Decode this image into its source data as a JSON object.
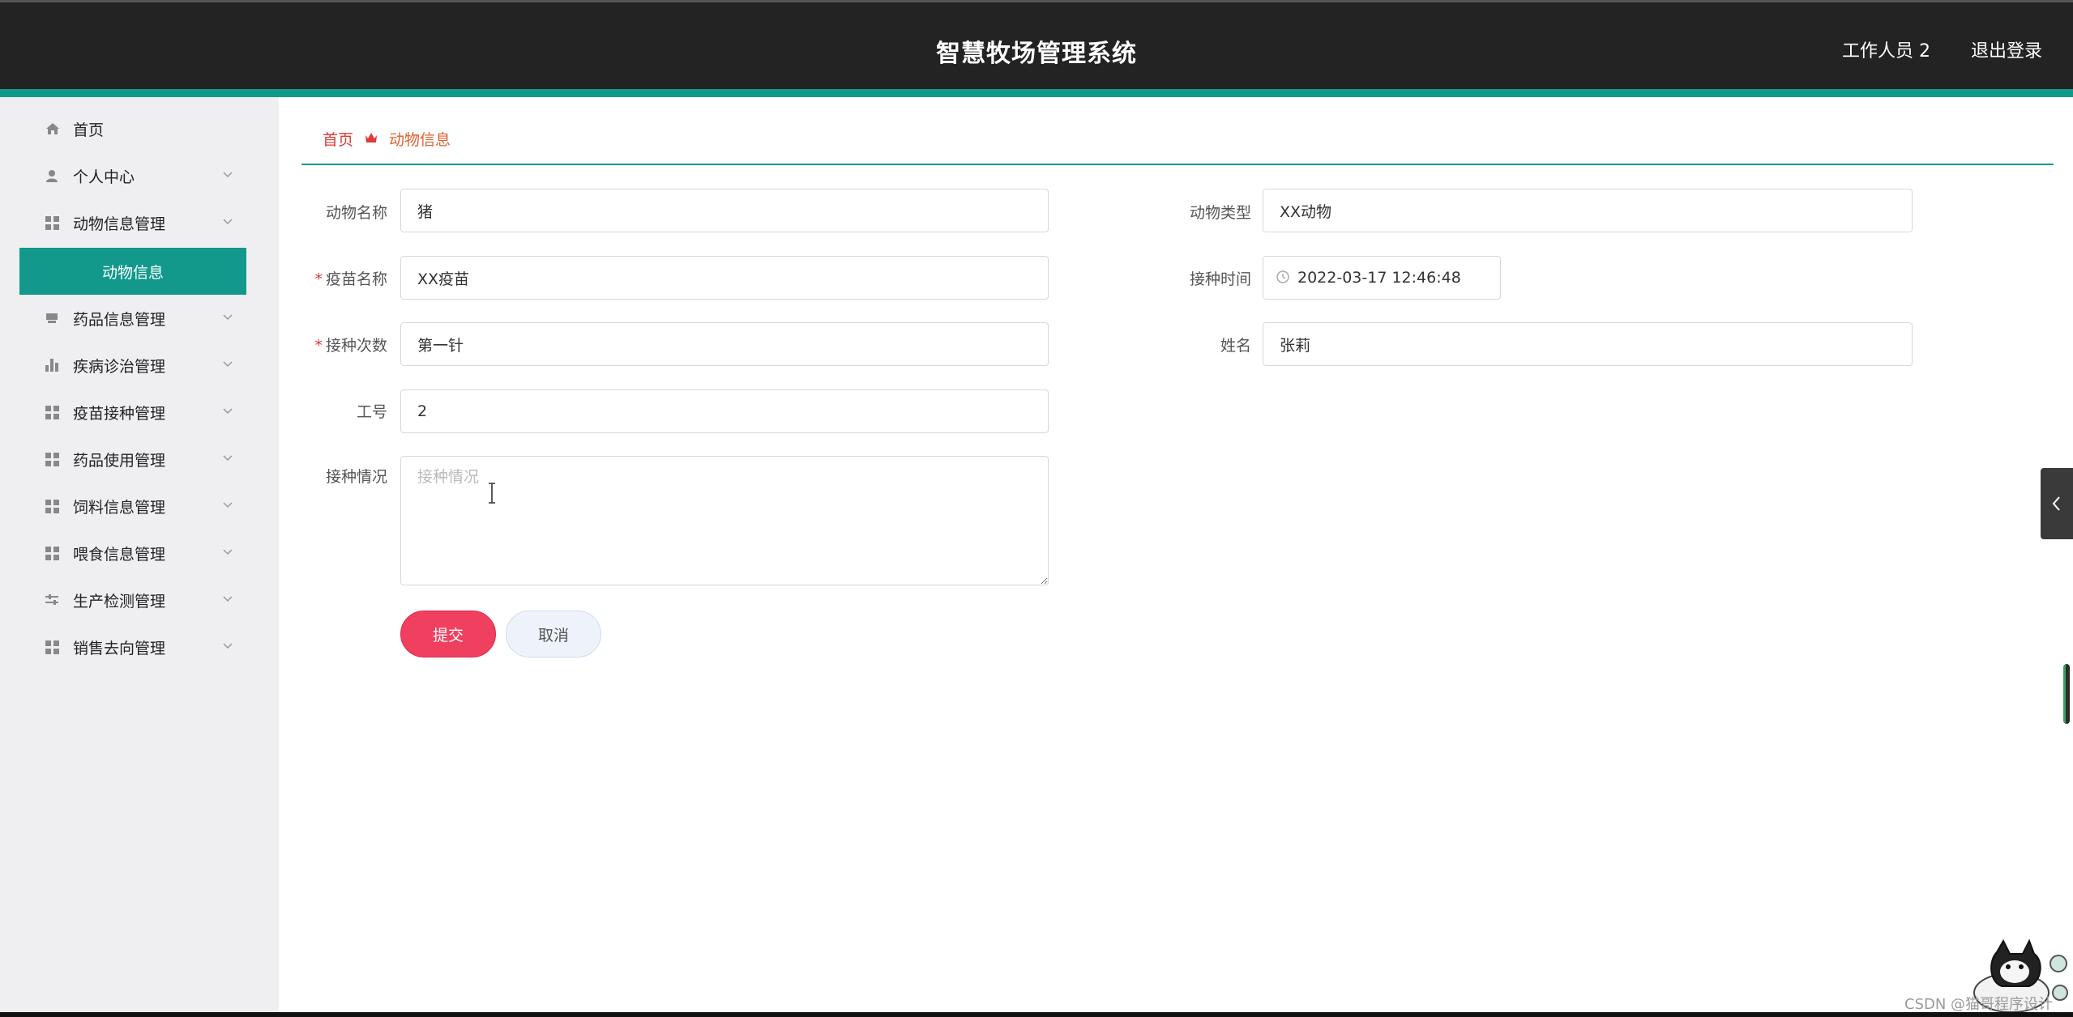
{
  "header": {
    "title": "智慧牧场管理系统",
    "user_label": "工作人员 2",
    "logout_label": "退出登录"
  },
  "sidebar": {
    "items": [
      {
        "label": "首页",
        "icon": "home-icon"
      },
      {
        "label": "个人中心",
        "icon": "user-icon"
      },
      {
        "label": "动物信息管理",
        "icon": "grid-icon"
      },
      {
        "label": "药品信息管理",
        "icon": "box-icon"
      },
      {
        "label": "疾病诊治管理",
        "icon": "bar-chart-icon"
      },
      {
        "label": "疫苗接种管理",
        "icon": "grid-icon"
      },
      {
        "label": "药品使用管理",
        "icon": "grid-icon"
      },
      {
        "label": "饲料信息管理",
        "icon": "grid-icon"
      },
      {
        "label": "喂食信息管理",
        "icon": "grid-icon"
      },
      {
        "label": "生产检测管理",
        "icon": "sliders-icon"
      },
      {
        "label": "销售去向管理",
        "icon": "grid-icon"
      }
    ],
    "active_sub": "动物信息"
  },
  "breadcrumb": {
    "home": "首页",
    "current": "动物信息"
  },
  "form": {
    "animal_name": {
      "label": "动物名称",
      "value": "猪"
    },
    "animal_type": {
      "label": "动物类型",
      "value": "XX动物"
    },
    "vaccine_name": {
      "label": "疫苗名称",
      "value": "XX疫苗",
      "required": "*"
    },
    "vaccination_time": {
      "label": "接种时间",
      "value": "2022-03-17 12:46:48"
    },
    "vaccination_count": {
      "label": "接种次数",
      "value": "第一针",
      "required": "*"
    },
    "person_name": {
      "label": "姓名",
      "value": "张莉"
    },
    "staff_id": {
      "label": "工号",
      "value": "2"
    },
    "vaccination_status": {
      "label": "接种情况",
      "placeholder": "接种情况",
      "value": ""
    },
    "submit_label": "提交",
    "cancel_label": "取消"
  },
  "watermark": "CSDN @猫哥程序设计",
  "colors": {
    "header_bg": "#232323",
    "accent": "#13998b",
    "sidebar_bg": "#efeff2",
    "submit": "#f04060",
    "breadcrumb_home": "#e03a3a",
    "breadcrumb_current": "#e0612e"
  }
}
